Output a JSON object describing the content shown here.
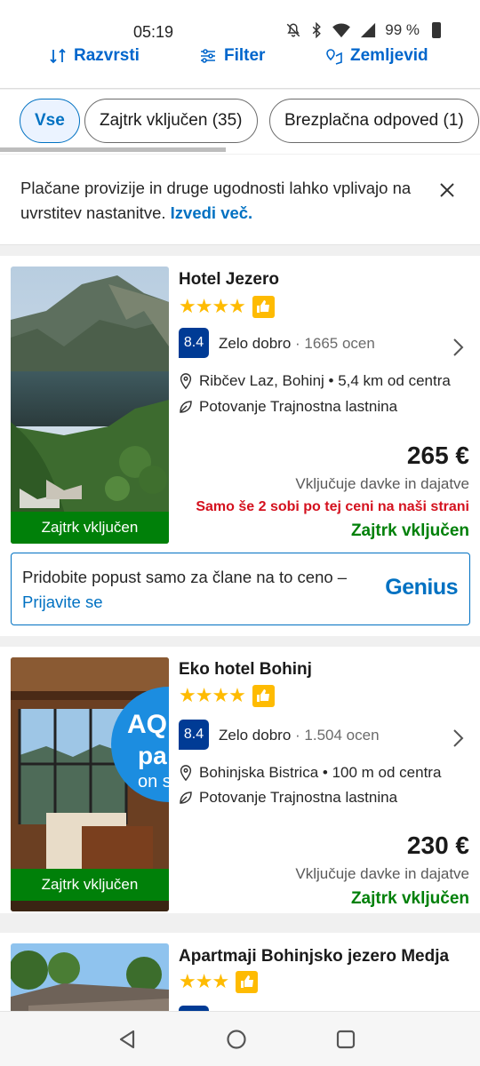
{
  "status": {
    "time": "05:19",
    "battery": "99 %"
  },
  "toolbar": {
    "sort_label": "Razvrsti",
    "filter_label": "Filter",
    "map_label": "Zemljevid"
  },
  "chips": [
    {
      "label": "Vse"
    },
    {
      "label": "Zajtrk vključen (35)"
    },
    {
      "label": "Brezplačna odpoved (1)"
    }
  ],
  "notice": {
    "text": "Plačane provizije in druge ugodnosti lahko vplivajo na uvrstitev nastanitve. ",
    "link": "Izvedi več."
  },
  "hotels": [
    {
      "name": "Hotel Jezero",
      "stars": "★★★★",
      "score": "8.4",
      "score_word": "Zelo dobro",
      "reviews": "1665 ocen",
      "location": "Ribčev Laz, Bohinj • 5,4 km od centra",
      "sustainability": "Potovanje Trajnostna lastnina",
      "price": "265 €",
      "tax": "Vključuje davke in dajatve",
      "urgent": "Samo še 2 sobi po tej ceni na naši strani",
      "breakfast": "Zajtrk vključen",
      "photo_badge": "Zajtrk vključen"
    },
    {
      "name": "Eko hotel Bohinj",
      "stars": "★★★★",
      "score": "8.4",
      "score_word": "Zelo dobro",
      "reviews": "1.504 ocen",
      "location": "Bohinjska Bistrica • 100 m od centra",
      "sustainability": "Potovanje Trajnostna lastnina",
      "price": "230 €",
      "tax": "Vključuje davke in dajatve",
      "breakfast": "Zajtrk vključen",
      "photo_badge": "Zajtrk vključen",
      "photo_overlay": [
        "AQ",
        "pa",
        "on s"
      ]
    },
    {
      "name": "Apartmaji Bohinjsko jezero Medja",
      "stars": "★★★"
    }
  ],
  "genius": {
    "text": "Pridobite popust samo za člane na to ceno – ",
    "link": "Prijavite se",
    "logo": "Genius"
  }
}
